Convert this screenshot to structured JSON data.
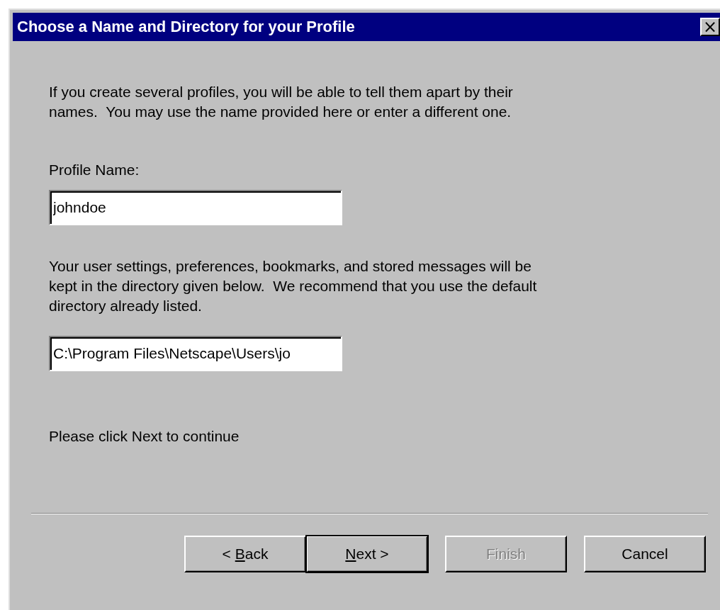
{
  "window": {
    "title": "Choose a Name and Directory for your Profile",
    "close": "×"
  },
  "intro": "If you create several profiles, you will be able to tell them apart by their names.  You may use the name provided here or enter a different one.",
  "profile_name": {
    "label": "Profile Name:",
    "value": "johndoe"
  },
  "directory_note": "Your user settings, preferences, bookmarks, and stored messages will be kept in the directory given below.  We recommend that you use the default directory already listed.",
  "directory": {
    "value": "C:\\Program Files\\Netscape\\Users\\jo"
  },
  "hint": "Please click Next to continue",
  "buttons": [
    {
      "before": "< ",
      "key": "B",
      "after": "ack",
      "default": false,
      "disabled": false
    },
    {
      "key": "N",
      "after": "ext >",
      "default": true,
      "disabled": false
    },
    {
      "before": "Finish",
      "default": false,
      "disabled": true
    },
    {
      "before": "Cancel",
      "default": false,
      "disabled": false
    }
  ]
}
